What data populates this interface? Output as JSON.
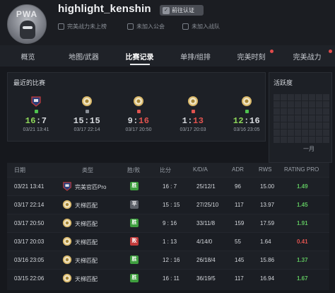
{
  "profile": {
    "logo_text": "PWA",
    "username": "highlight_kenshin",
    "verify_label": "前往认证",
    "meta": [
      "完美战力未上榜",
      "未加入公会",
      "未加入战队"
    ]
  },
  "tabs": [
    {
      "label": "概览",
      "active": false,
      "dot": false
    },
    {
      "label": "地图/武器",
      "active": false,
      "dot": false
    },
    {
      "label": "比赛记录",
      "active": true,
      "dot": false
    },
    {
      "label": "单排/组排",
      "active": false,
      "dot": false
    },
    {
      "label": "完美时刻",
      "active": false,
      "dot": true
    },
    {
      "label": "完美战力",
      "active": false,
      "dot": true
    }
  ],
  "recent": {
    "title": "最近的比赛",
    "matches": [
      {
        "a": "16",
        "b": "7",
        "date": "03/21 13:41",
        "result": "win",
        "icon": "pro-league-icon"
      },
      {
        "a": "15",
        "b": "15",
        "date": "03/17 22:14",
        "result": "tie",
        "icon": "ladder-icon"
      },
      {
        "a": "9",
        "b": "16",
        "date": "03/17 20:50",
        "result": "loss",
        "icon": "ladder-icon"
      },
      {
        "a": "1",
        "b": "13",
        "date": "03/17 20:03",
        "result": "loss",
        "icon": "ladder-icon"
      },
      {
        "a": "12",
        "b": "16",
        "date": "03/16 23:05",
        "result": "win",
        "icon": "ladder-icon"
      }
    ]
  },
  "activity": {
    "title": "活跃度",
    "month_label": "一月"
  },
  "table": {
    "headers": [
      "日期",
      "类型",
      "胜/败",
      "比分",
      "K/D/A",
      "ADR",
      "RWS",
      "RATING PRO"
    ],
    "rows": [
      {
        "date": "03/21 13:41",
        "type": "完美官匹Pro",
        "type_icon": "pro-league-icon",
        "result": "胜",
        "result_kind": "win",
        "score": "16 : 7",
        "kda": "25/12/1",
        "adr": "96",
        "rws": "15.00",
        "rating": "1.49"
      },
      {
        "date": "03/17 22:14",
        "type": "天梯匹配",
        "type_icon": "ladder-icon",
        "result": "平",
        "result_kind": "tie",
        "score": "15 : 15",
        "kda": "27/25/10",
        "adr": "117",
        "rws": "13.97",
        "rating": "1.45"
      },
      {
        "date": "03/17 20:50",
        "type": "天梯匹配",
        "type_icon": "ladder-icon",
        "result": "胜",
        "result_kind": "win",
        "score": "9 : 16",
        "kda": "33/11/8",
        "adr": "159",
        "rws": "17.59",
        "rating": "1.91"
      },
      {
        "date": "03/17 20:03",
        "type": "天梯匹配",
        "type_icon": "ladder-icon",
        "result": "败",
        "result_kind": "loss",
        "score": "1 : 13",
        "kda": "4/14/0",
        "adr": "55",
        "rws": "1.64",
        "rating": "0.41"
      },
      {
        "date": "03/16 23:05",
        "type": "天梯匹配",
        "type_icon": "ladder-icon",
        "result": "胜",
        "result_kind": "win",
        "score": "12 : 16",
        "kda": "26/18/4",
        "adr": "145",
        "rws": "15.86",
        "rating": "1.37"
      },
      {
        "date": "03/15 22:06",
        "type": "天梯匹配",
        "type_icon": "ladder-icon",
        "result": "胜",
        "result_kind": "win",
        "score": "16 : 11",
        "kda": "36/19/5",
        "adr": "117",
        "rws": "16.94",
        "rating": "1.67"
      }
    ]
  },
  "colors": {
    "win": "#4fc34f",
    "loss": "#e0534f",
    "tie": "#8a8f97",
    "score_a_win": "#8fd85a",
    "score_b_win": "#d7dade",
    "score_loss_b": "#e0534f",
    "tie_color": "#d7dade",
    "rating_good": "#5ec25e",
    "rating_bad": "#e0534f",
    "badge_win": "#3f9f3f",
    "badge_loss": "#c23b3b",
    "badge_tie": "#5d6169"
  }
}
